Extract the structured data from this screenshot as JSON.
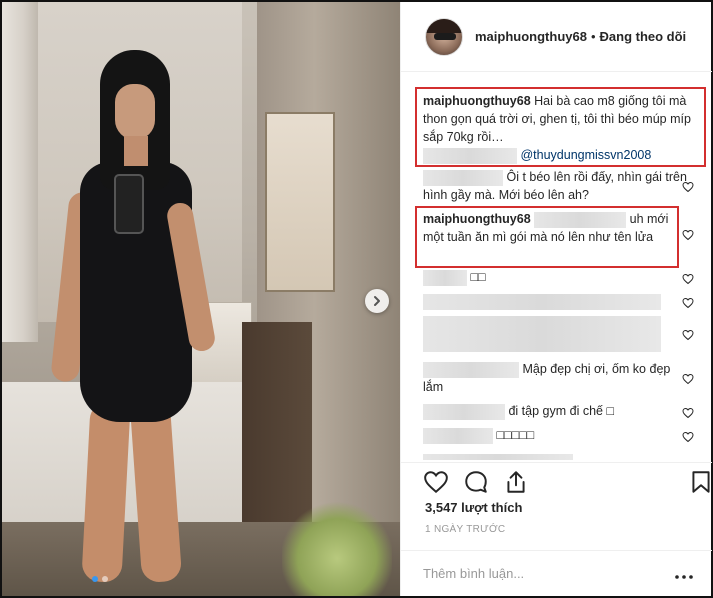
{
  "post": {
    "carousel_index": 1,
    "carousel_total": 2
  },
  "header": {
    "username": "maiphuongthuy68",
    "separator": "•",
    "follow_status": "Đang theo dõi"
  },
  "comments": [
    {
      "user": "maiphuongthuy68",
      "text": "Hai bà cao m8 giống tôi mà thon gọn quá trời ơi, ghen tị, tôi thì béo múp míp sắp 70kg rồi…",
      "mention": "@thuydungmissvn2008",
      "highlighted": true
    },
    {
      "user": "",
      "text": "Ôi t béo lên rồi đấy, nhìn gái trên hình gầy mà. Mới béo lên ah?",
      "highlighted": false
    },
    {
      "user": "maiphuongthuy68",
      "text_after": "uh",
      "text": "mới một tuần ăn mì gói mà nó lên như tên lửa",
      "highlighted": true
    },
    {
      "user": "",
      "text": "□□",
      "highlighted": false
    },
    {
      "user": "",
      "text": "",
      "highlighted": false
    },
    {
      "user": "",
      "text": "",
      "highlighted": false
    },
    {
      "user": "",
      "text": "Mập đẹp chị ơi, ốm ko đẹp lắm",
      "highlighted": false
    },
    {
      "user": "",
      "text": "đi tập gym đi chế □",
      "highlighted": false
    },
    {
      "user": "",
      "text": "□□□□□",
      "highlighted": false
    },
    {
      "user": "",
      "text": "",
      "highlighted": false
    }
  ],
  "footer": {
    "likes": "3,547 lượt thích",
    "time": "1 NGÀY TRƯỚC",
    "comment_placeholder": "Thêm bình luận...",
    "more_label": "•••"
  },
  "colors": {
    "highlight_box": "#d32f2f",
    "mention": "#003569",
    "carousel_active": "#3897f0"
  },
  "icons": [
    "heart-icon",
    "comment-icon",
    "share-icon",
    "bookmark-icon",
    "chevron-right-icon",
    "more-icon"
  ]
}
